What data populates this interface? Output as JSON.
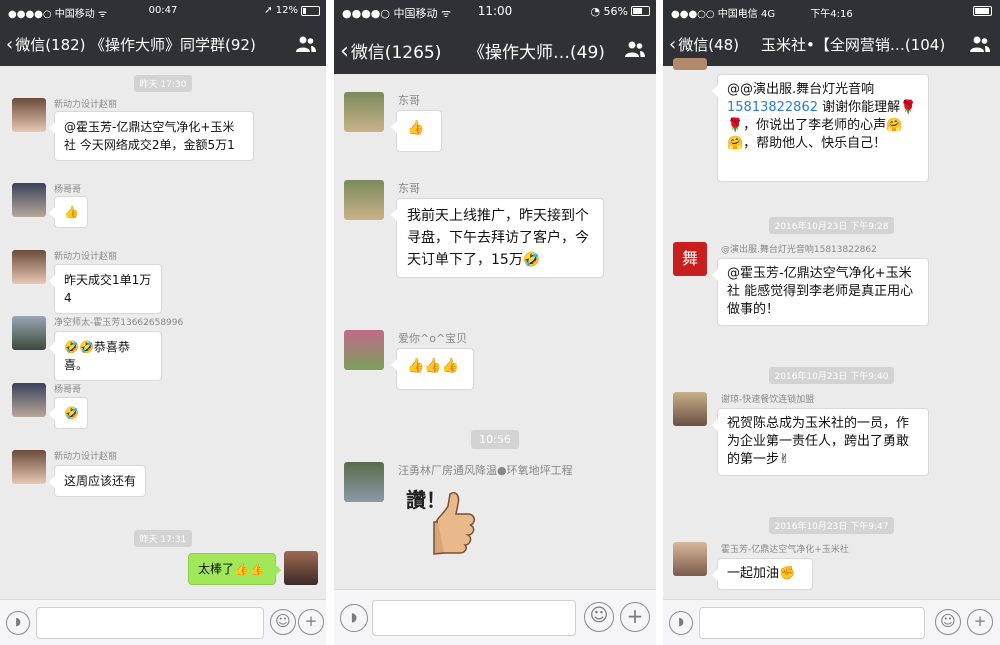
{
  "phone1": {
    "status": {
      "carrier": "●●●●○ 中国移动 ᯤ",
      "time": "00:47",
      "battery": "➚ 12%"
    },
    "nav": {
      "back": "微信(182)",
      "title": "《操作大师》同学群(92)"
    },
    "messages": [
      {
        "time": "昨天 17:30"
      },
      {
        "sender": "新动力设计赵丽",
        "text": "@霍玉芳-亿鼎达空气净化+玉米社 今天网络成交2单，金额5万1"
      },
      {
        "sender": "杨哥哥",
        "text": "👍"
      },
      {
        "sender": "新动力设计赵丽",
        "text": "昨天成交1单1万4"
      },
      {
        "sender": "净空师太-霍玉芳13662658996",
        "text": "🤣🤣恭喜恭喜。"
      },
      {
        "sender": "杨哥哥",
        "text": "🤣"
      },
      {
        "sender": "新动力设计赵丽",
        "text": "这周应该还有"
      },
      {
        "time": "昨天 17:31"
      },
      {
        "text": "太棒了👍👍",
        "self": true
      }
    ]
  },
  "phone2": {
    "status": {
      "carrier": "●●●●○ 中国移动 ᯤ",
      "time": "11:00",
      "battery": "◔ 56%"
    },
    "nav": {
      "back": "微信(1265)",
      "title": "《操作大师…(49)"
    },
    "messages": [
      {
        "sender": "东哥",
        "text": "👍"
      },
      {
        "sender": "东哥",
        "text": "我前天上线推广，昨天接到个寻盘，下午去拜访了客户，今天订单下了，15万🤣"
      },
      {
        "sender": "爱你^o^宝贝",
        "text": "👍👍👍"
      },
      {
        "time": "10:56"
      },
      {
        "sender": "汪勇林厂房通风降温●环氧地坪工程",
        "sticker": "讚！"
      }
    ]
  },
  "phone3": {
    "status": {
      "carrier": "●●●○○ 中国电信 4G",
      "time": "下午4:16",
      "battery": ""
    },
    "nav": {
      "back": "微信(48)",
      "title": "玉米社•【全网营销…(104)"
    },
    "messages": [
      {
        "text_parts": [
          "@@演出服.舞台灯光音响",
          "15813822862",
          "谢谢你能理解🌹🌹，你说出了李老师的心声🤗🤗，帮助他人、快乐自己！"
        ]
      },
      {
        "time": "2016年10月23日 下午9:28"
      },
      {
        "sender": "@演出服.舞台灯光音响15813822862",
        "text": "@霍玉芳-亿鼎达空气净化+玉米社 能感觉得到李老师是真正用心做事的！"
      },
      {
        "time": "2016年10月23日 下午9:40"
      },
      {
        "sender": "谢琼-快速餐饮连锁加盟",
        "text": "祝贺陈总成为玉米社的一员，作为企业第一责任人，跨出了勇敢的第一步✌"
      },
      {
        "time": "2016年10月23日 下午9:47"
      },
      {
        "sender": "霍玉芳-亿鼎达空气净化+玉米社",
        "text": "一起加油✊"
      }
    ]
  },
  "icons": {
    "back": "chevron-left-icon",
    "members": "group-members-icon",
    "voice": "voice-icon",
    "emoji": "emoji-icon",
    "plus": "plus-icon"
  }
}
